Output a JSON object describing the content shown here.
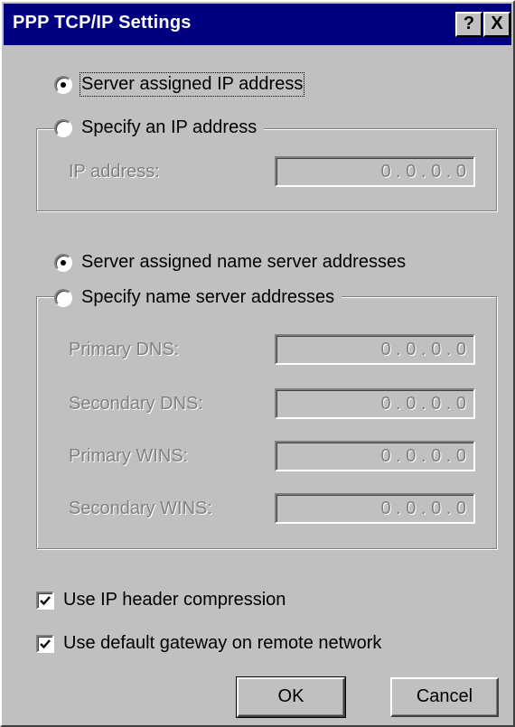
{
  "window": {
    "title": "PPP TCP/IP Settings",
    "help_label": "?",
    "close_label": "X"
  },
  "ip_section": {
    "server_assigned_label": "Server assigned IP address",
    "specify_label": "Specify an IP address",
    "ip_address_label": "IP address:",
    "ip_address_value": "0  .  0  .  0  .  0",
    "selected": "server_assigned"
  },
  "dns_section": {
    "server_assigned_label": "Server assigned name server addresses",
    "specify_label": "Specify name server addresses",
    "selected": "server_assigned",
    "fields": [
      {
        "label": "Primary DNS:",
        "value": "0  .  0  .  0  .  0"
      },
      {
        "label": "Secondary DNS:",
        "value": "0  .  0  .  0  .  0"
      },
      {
        "label": "Primary WINS:",
        "value": "0  .  0  .  0  .  0"
      },
      {
        "label": "Secondary WINS:",
        "value": "0  .  0  .  0  .  0"
      }
    ]
  },
  "options": {
    "header_compression_label": "Use IP header compression",
    "header_compression_checked": true,
    "default_gateway_label": "Use default gateway on remote network",
    "default_gateway_checked": true
  },
  "buttons": {
    "ok_label": "OK",
    "cancel_label": "Cancel"
  },
  "colors": {
    "titlebar": "#000080",
    "face": "#c0c0c0",
    "disabled_text": "#808080"
  }
}
